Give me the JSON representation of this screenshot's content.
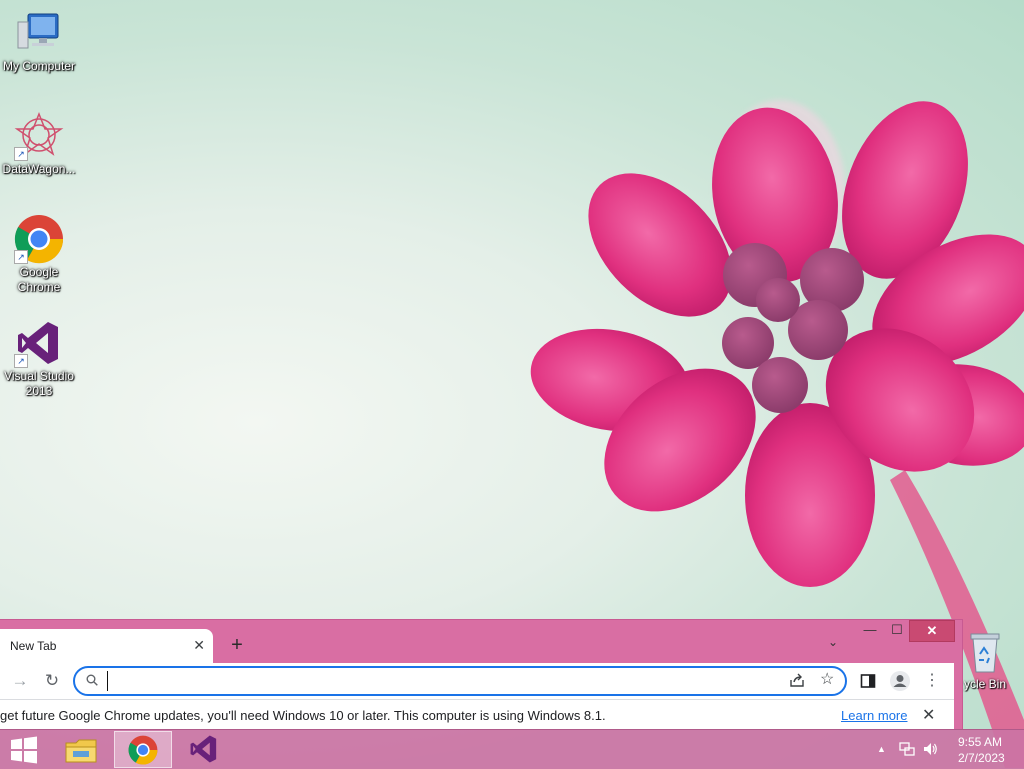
{
  "desktop": {
    "icons": [
      {
        "label": "My Computer"
      },
      {
        "label": "DataWagon..."
      },
      {
        "label": "Google Chrome"
      },
      {
        "label": "Visual Studio 2013"
      }
    ],
    "recycle_bin_label": "ycle Bin"
  },
  "chrome": {
    "tab_title": "New Tab",
    "tab_close": "✕",
    "new_tab": "+",
    "tab_search": "⌄",
    "minimize": "—",
    "maximize": "☐",
    "close": "✕",
    "back_fwd": "→",
    "reload": "↻",
    "omnibox_value": "",
    "star": "☆",
    "menu": "⋮",
    "infobar": {
      "message": "get future Google Chrome updates, you'll need Windows 10 or later. This computer is using Windows 8.1.",
      "link": "Learn more",
      "close": "✕"
    }
  },
  "taskbar": {
    "clock_time": "9:55 AM",
    "clock_date": "2/7/2023",
    "tray_chevron": "▲"
  },
  "colors": {
    "accent": "#1a73e8",
    "window_frame": "#d96ea3",
    "taskbar": "#cb73a4"
  }
}
